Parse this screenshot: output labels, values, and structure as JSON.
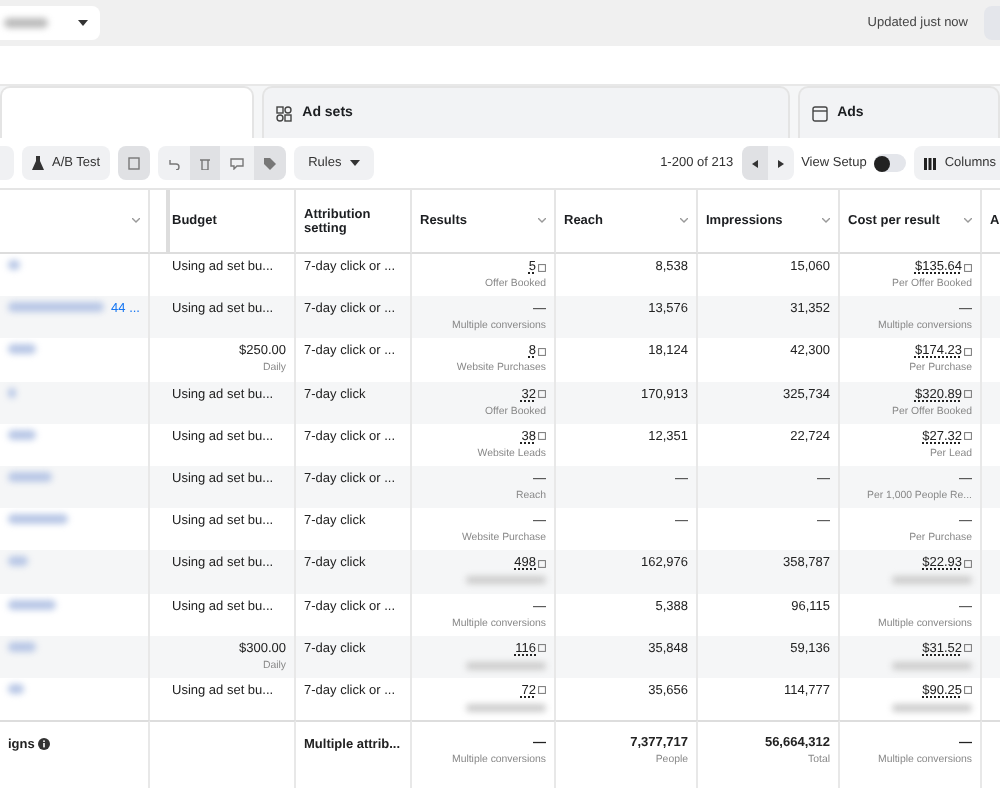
{
  "top_bar": {
    "status": "Updated just now"
  },
  "tabs": [
    {
      "kind": "blank",
      "selected": true
    },
    {
      "kind": "adsets",
      "label": "Ad sets",
      "selected": false
    },
    {
      "kind": "ads",
      "label": "Ads",
      "selected": false
    }
  ],
  "toolbar": {
    "ab_test": "A/B Test",
    "rules": "Rules",
    "range": "1-200 of 213",
    "view_setup": {
      "label": "View Setup",
      "on": false
    },
    "columns": "Columns"
  },
  "table": {
    "columns": [
      {
        "label": "Budget",
        "sortable": false
      },
      {
        "label": "Attribution setting",
        "sortable": false
      },
      {
        "label": "Results",
        "sortable": true
      },
      {
        "label": "Reach",
        "sortable": true
      },
      {
        "label": "Impressions",
        "sortable": true
      },
      {
        "label": "Cost per result",
        "sortable": true
      },
      {
        "label": "A",
        "sortable": false
      }
    ],
    "rows": [
      {
        "budget": {
          "value": "Using ad set bu..."
        },
        "attribution": "7-day click or ...",
        "results": {
          "value": "5",
          "linked": true,
          "sub": "Offer Booked"
        },
        "reach": "8,538",
        "impressions": "15,060",
        "cost": {
          "value": "$135.64",
          "linked": true,
          "sub": "Per Offer Booked"
        }
      },
      {
        "name_tail": "44 ...",
        "budget": {
          "value": "Using ad set bu..."
        },
        "attribution": "7-day click or ...",
        "results": {
          "value": "—",
          "linked": false,
          "sub": "Multiple conversions"
        },
        "reach": "13,576",
        "impressions": "31,352",
        "cost": {
          "value": "—",
          "linked": false,
          "sub": "Multiple conversions"
        }
      },
      {
        "budget": {
          "value": "$250.00",
          "sub": "Daily"
        },
        "attribution": "7-day click or ...",
        "results": {
          "value": "8",
          "linked": true,
          "sub": "Website Purchases"
        },
        "reach": "18,124",
        "impressions": "42,300",
        "cost": {
          "value": "$174.23",
          "linked": true,
          "sub": "Per Purchase"
        }
      },
      {
        "budget": {
          "value": "Using ad set bu..."
        },
        "attribution": "7-day click",
        "results": {
          "value": "32",
          "linked": true,
          "sub": "Offer Booked"
        },
        "reach": "170,913",
        "impressions": "325,734",
        "cost": {
          "value": "$320.89",
          "linked": true,
          "sub": "Per Offer Booked"
        }
      },
      {
        "budget": {
          "value": "Using ad set bu..."
        },
        "attribution": "7-day click or ...",
        "results": {
          "value": "38",
          "linked": true,
          "sub": "Website Leads"
        },
        "reach": "12,351",
        "impressions": "22,724",
        "cost": {
          "value": "$27.32",
          "linked": true,
          "sub": "Per Lead"
        }
      },
      {
        "budget": {
          "value": "Using ad set bu..."
        },
        "attribution": "7-day click or ...",
        "results": {
          "value": "—",
          "linked": false,
          "sub": "Reach"
        },
        "reach": "—",
        "impressions": "—",
        "cost": {
          "value": "—",
          "linked": false,
          "sub": "Per 1,000 People Re..."
        }
      },
      {
        "budget": {
          "value": "Using ad set bu..."
        },
        "attribution": "7-day click",
        "results": {
          "value": "—",
          "linked": false,
          "sub": "Website Purchase"
        },
        "reach": "—",
        "impressions": "—",
        "cost": {
          "value": "—",
          "linked": false,
          "sub": "Per Purchase"
        }
      },
      {
        "budget": {
          "value": "Using ad set bu..."
        },
        "attribution": "7-day click",
        "results": {
          "value": "498",
          "linked": true,
          "sub_hidden": true
        },
        "reach": "162,976",
        "impressions": "358,787",
        "cost": {
          "value": "$22.93",
          "linked": true,
          "sub_hidden": true
        }
      },
      {
        "budget": {
          "value": "Using ad set bu..."
        },
        "attribution": "7-day click or ...",
        "results": {
          "value": "—",
          "linked": false,
          "sub": "Multiple conversions"
        },
        "reach": "5,388",
        "impressions": "96,115",
        "cost": {
          "value": "—",
          "linked": false,
          "sub": "Multiple conversions"
        }
      },
      {
        "budget": {
          "value": "$300.00",
          "sub": "Daily"
        },
        "attribution": "7-day click",
        "results": {
          "value": "116",
          "linked": true,
          "sub_hidden": true
        },
        "reach": "35,848",
        "impressions": "59,136",
        "cost": {
          "value": "$31.52",
          "linked": true,
          "sub_hidden": true
        }
      },
      {
        "budget": {
          "value": "Using ad set bu..."
        },
        "attribution": "7-day click or ...",
        "results": {
          "value": "72",
          "linked": true,
          "sub_hidden": true
        },
        "reach": "35,656",
        "impressions": "114,777",
        "cost": {
          "value": "$90.25",
          "linked": true,
          "sub_hidden": true
        }
      }
    ],
    "total": {
      "label": "igns",
      "attribution": "Multiple attrib...",
      "results": {
        "value": "—",
        "sub": "Multiple conversions"
      },
      "reach": {
        "value": "7,377,717",
        "sub": "People"
      },
      "impressions": {
        "value": "56,664,312",
        "sub": "Total"
      },
      "cost": {
        "value": "—",
        "sub": "Multiple conversions"
      }
    }
  }
}
